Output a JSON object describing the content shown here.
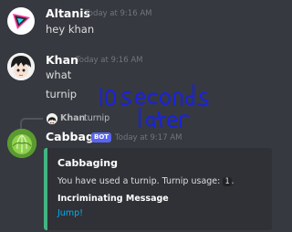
{
  "messages": [
    {
      "author": "Altanis",
      "timestamp": "Today at 9:16 AM",
      "text": "hey khan"
    },
    {
      "author": "Khan",
      "timestamp": "Today at 9:16 AM",
      "text": "what",
      "text2": "turnip"
    }
  ],
  "annotation": {
    "line1": "10 seconds",
    "line2": "later"
  },
  "reply_reference": {
    "author": "Khan",
    "text": "turnip"
  },
  "bot_message": {
    "author": "Cabbage",
    "badge": "BOT",
    "timestamp": "Today at 9:17 AM",
    "embed": {
      "title": "Cabbaging",
      "description_prefix": "You have used a turnip. Turnip usage:",
      "usage_count": "1",
      "description_suffix": ".",
      "field_name": "Incriminating Message",
      "link_text": "Jump!"
    }
  },
  "colors": {
    "background": "#36393f",
    "embed_accent": "#43b581",
    "link": "#00aff4",
    "bot_badge": "#5865f2"
  }
}
